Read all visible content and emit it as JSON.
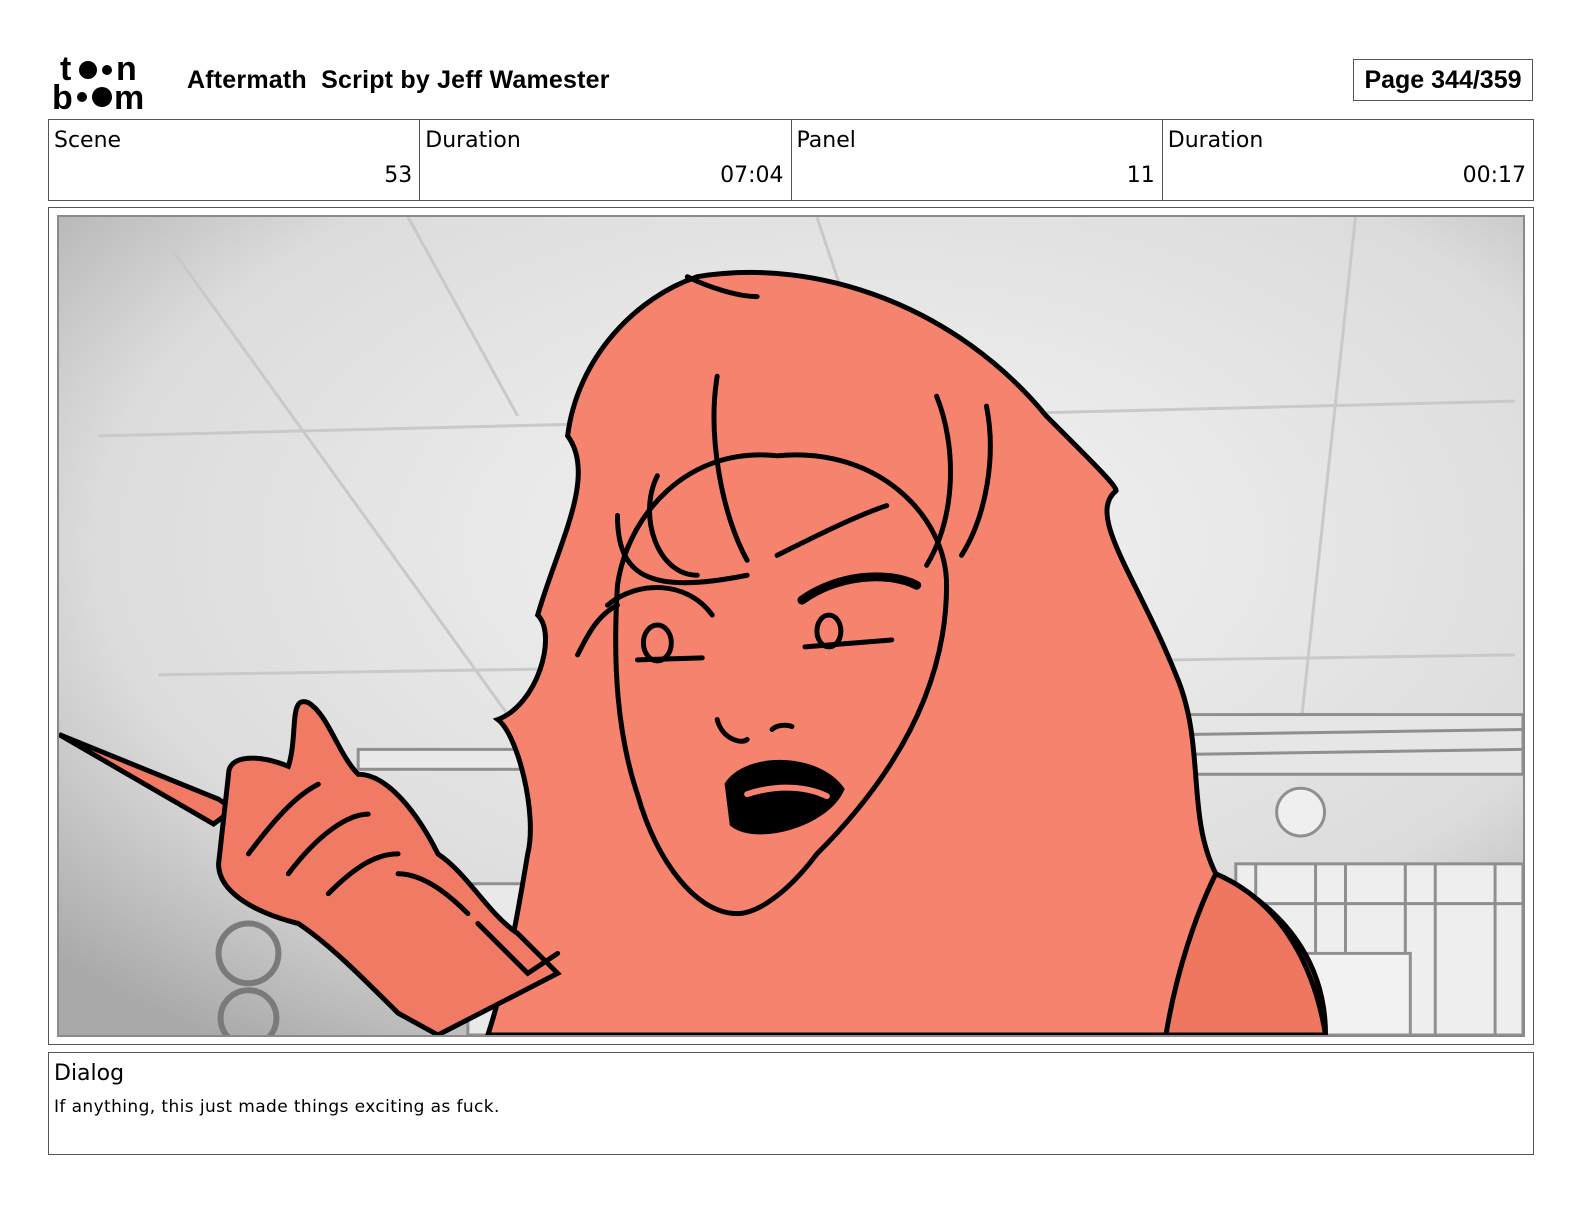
{
  "header": {
    "logo_text": "toonboom",
    "title": "Aftermath  Script by Jeff Wamester",
    "page_label": "Page 344/359"
  },
  "meta": [
    {
      "label": "Scene",
      "value": "53"
    },
    {
      "label": "Duration",
      "value": "07:04"
    },
    {
      "label": "Panel",
      "value": "11"
    },
    {
      "label": "Duration",
      "value": "00:17"
    }
  ],
  "panel": {
    "fill_color": "#f6836d",
    "line_color": "#000000"
  },
  "dialog": {
    "label": "Dialog",
    "text": "If anything, this just made things exciting as fuck."
  }
}
